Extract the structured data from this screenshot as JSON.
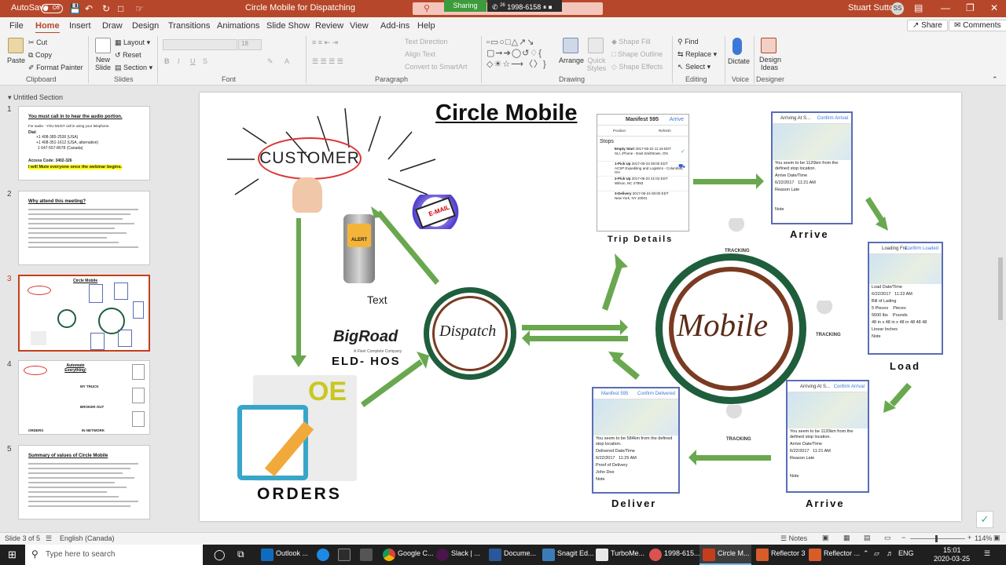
{
  "titlebar": {
    "autosave": "AutoSave",
    "autosave_state": "Off",
    "doc_title": "Circle Mobile for Dispatching",
    "sharing": "Sharing",
    "call_label": "1998-6158",
    "call_count": "26",
    "user": "Stuart Sutton",
    "user_initials": "SS"
  },
  "menu": {
    "tabs": [
      "File",
      "Home",
      "Insert",
      "Draw",
      "Design",
      "Transitions",
      "Animations",
      "Slide Show",
      "Review",
      "View",
      "Add-ins",
      "Help"
    ],
    "share": "Share",
    "comments": "Comments"
  },
  "ribbon": {
    "clipboard": {
      "paste": "Paste",
      "cut": "Cut",
      "copy": "Copy",
      "format_painter": "Format Painter",
      "group": "Clipboard"
    },
    "slides": {
      "new_slide": "New Slide",
      "layout": "Layout",
      "reset": "Reset",
      "section": "Section",
      "group": "Slides"
    },
    "font": {
      "size": "18",
      "group": "Font"
    },
    "paragraph": {
      "text_direction": "Text Direction",
      "align_text": "Align Text",
      "smartart": "Convert to SmartArt",
      "group": "Paragraph"
    },
    "drawing": {
      "arrange": "Arrange",
      "quick_styles": "Quick Styles",
      "shape_fill": "Shape Fill",
      "shape_outline": "Shape Outline",
      "shape_effects": "Shape Effects",
      "group": "Drawing"
    },
    "editing": {
      "find": "Find",
      "replace": "Replace",
      "select": "Select",
      "group": "Editing"
    },
    "voice": {
      "dictate": "Dictate",
      "group": "Voice"
    },
    "designer": {
      "design_ideas": "Design Ideas",
      "group": "Designer"
    }
  },
  "thumbs": {
    "section": "Untitled Section",
    "slides": [
      {
        "num": "1",
        "title": "You must call in to hear the audio portion.",
        "lines": [
          "For audio - YOU MUST call in using your telephone.",
          "Dial:",
          "+1 408-385-2536 (USA)",
          "+1 408-351-1612 (USA, alternative)",
          "1 647-557-8678 (Canada)",
          "Access Code: 3402-326"
        ],
        "highlight": "I will Mute everyone once the webinar begins."
      },
      {
        "num": "2",
        "title": "Why attend this meeting?"
      },
      {
        "num": "3",
        "title": "Circle Mobile"
      },
      {
        "num": "4",
        "title": "Automate Everything!",
        "labels": [
          "MY TRUCK",
          "BROKER OUT",
          "IN NETWORK",
          "ORDERS"
        ]
      },
      {
        "num": "5",
        "title": "Summary of values of Circle Mobile"
      }
    ]
  },
  "slide": {
    "title": "Circle Mobile",
    "customer": "CUSTOMER",
    "text_label": "Text",
    "alert": "ALERT",
    "email": "E-MAIL",
    "bigroad": "BigRoad",
    "bigroad_sub": "A Fleet Complete Company",
    "eld": "ELD- HOS",
    "oe": "OE",
    "orders": "ORDERS",
    "dispatch": "Dispatch",
    "mobile": "Mobile",
    "tracking": "TRACKING",
    "trip": {
      "label": "Trip Details",
      "header": "Manifest 595",
      "action": "Arrive",
      "position": "Position",
      "refresh": "Refresh",
      "stops": "Stops",
      "rows": [
        {
          "name": "Empty Start",
          "date": "2017-06-22 11:19 EDT",
          "addr": "SLI, iPhone - East Smithtown, ON"
        },
        {
          "name": "1-Pick Up",
          "date": "2017-06-23 08:00 EDT",
          "addr": "ACSP Expediting and Logistics - Columbus, OH"
        },
        {
          "name": "2-Pick Up",
          "date": "2017-06-23 21:02 EDT",
          "addr": "Wilson, NC 27893"
        },
        {
          "name": "3-Delivery",
          "date": "2017-06-24 08:00 EDT",
          "addr": "New York, NY 10001"
        }
      ]
    },
    "arrive1": {
      "label": "Arrive",
      "header": "Arriving At S...",
      "btn": "Confirm Arrival",
      "msg": "You seem to be 1120km from the defined stop location.",
      "f1": "Arrive Date/Time",
      "date": "6/22/2017",
      "time": "11:21 AM",
      "f2": "Reason Late",
      "note": "Note"
    },
    "load": {
      "label": "Load",
      "header": "Loading Fre...",
      "btn": "Confirm Loaded",
      "f1": "Load Date/Time",
      "date": "6/22/2017",
      "time": "11:22 AM",
      "f2": "Bill of Lading",
      "pieces": "5 Pieces",
      "pieces_lbl": "Pieces",
      "lbs": "5600 lbs",
      "lbs_lbl": "Pounds",
      "dims": "48 in x 48 in x 48 in",
      "d1": "48",
      "d2": "48",
      "d3": "48",
      "linear": "Linear Inches",
      "note": "Note"
    },
    "arrive2": {
      "label": "Arrive",
      "header": "Arriving At S...",
      "btn": "Confirm Arrival",
      "msg": "You seem to be 1120km from the defined stop location.",
      "f1": "Arrive Date/Time",
      "date": "6/22/2017",
      "time": "11:21 AM",
      "f2": "Reason Late",
      "note": "Note"
    },
    "deliver": {
      "label": "Deliver",
      "header": "Manifest 595",
      "btn": "Confirm Delivered",
      "msg": "You seem to be 584km from the defined stop location.",
      "f1": "Delivered Date/Time",
      "date": "6/22/2017",
      "time": "11:25 AM",
      "f2": "Proof of Delivery",
      "pod": "John Doe",
      "note": "Note"
    }
  },
  "status": {
    "slide": "Slide 3 of 5",
    "lang": "English (Canada)",
    "notes": "Notes",
    "zoom": "114%"
  },
  "taskbar": {
    "search": "Type here to search",
    "apps": [
      "Outlook ...",
      "Google C...",
      "Slack | ...",
      "Docume...",
      "Snagit Ed...",
      "TurboMe...",
      "1998-615...",
      "Circle M...",
      "Reflector 3",
      "Reflector ..."
    ],
    "lang": "ENG",
    "time": "15:01",
    "date": "2020-03-25"
  },
  "colors": {
    "accent": "#b7472a",
    "arrow": "#6aa84f",
    "circle": "#1e5e3c",
    "brown": "#7a3b22"
  }
}
